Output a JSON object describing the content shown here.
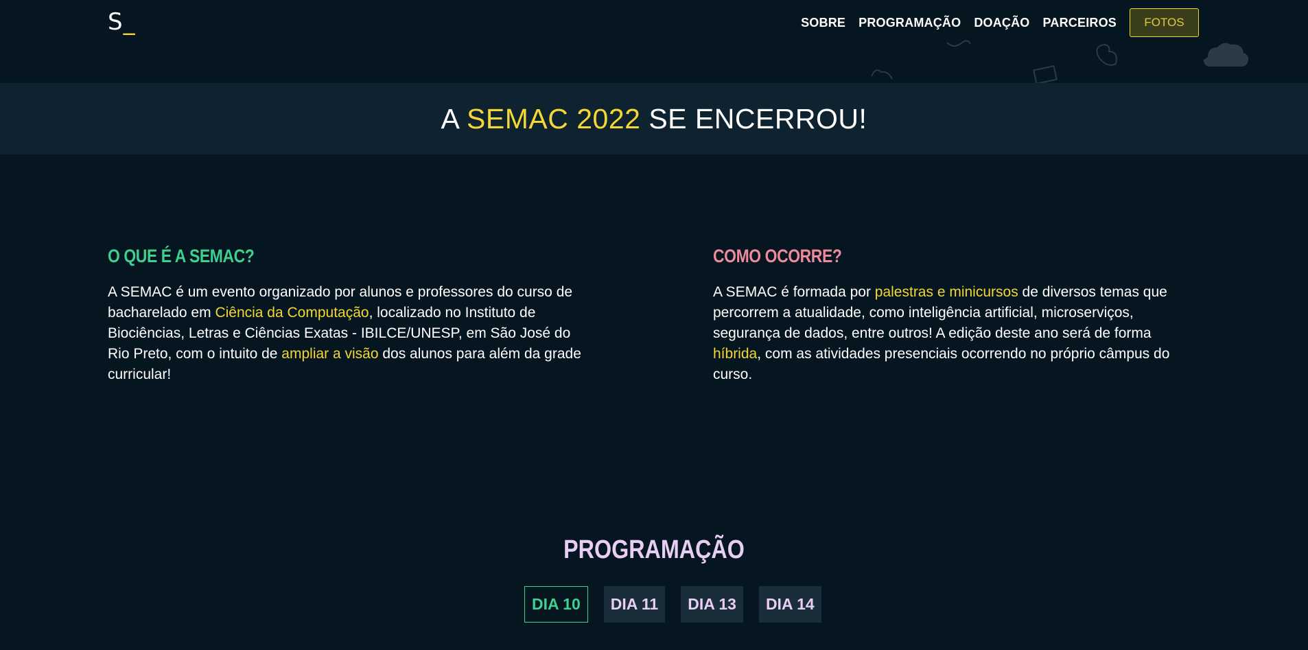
{
  "header": {
    "logo_letter": "S",
    "logo_cursor": "_",
    "nav": [
      "SOBRE",
      "PROGRAMAÇÃO",
      "DOAÇÃO",
      "PARCEIROS"
    ],
    "fotos_label": "FOTOS"
  },
  "banner": {
    "prefix": "A ",
    "highlight": "SEMAC 2022",
    "suffix": " SE ENCERROU!"
  },
  "about": {
    "title": "O QUE É A SEMAC?",
    "p1": "A SEMAC é um evento organizado por alunos e professores do curso de bacharelado em ",
    "hl1": "Ciência da Computação",
    "p2": ", localizado no Instituto de Biociências, Letras e Ciências Exatas - IBILCE/UNESP, em São José do Rio Preto, com o intuito de ",
    "hl2": "ampliar a visão",
    "p3": " dos alunos para além da grade curricular!"
  },
  "how": {
    "title": "COMO OCORRE?",
    "p1": "A SEMAC é formada por ",
    "hl1": "palestras e minicursos",
    "p2": " de diversos temas que percorrem a atualidade, como inteligência artificial, microserviços, segurança de dados, entre outros! A edição deste ano será de forma ",
    "hl2": "híbrida",
    "p3": ", com as atividades presenciais ocorrendo no próprio câmpus do curso."
  },
  "programacao": {
    "title": "PROGRAMAÇÃO",
    "tabs": [
      "DIA 10",
      "DIA 11",
      "DIA 13",
      "DIA 14"
    ]
  },
  "colors": {
    "background": "#061621",
    "banner": "#0e232f",
    "accent_yellow": "#f4d634",
    "accent_green": "#3fcf8e",
    "accent_pink": "#ef8a9c",
    "lavender": "#e8cdf5"
  }
}
